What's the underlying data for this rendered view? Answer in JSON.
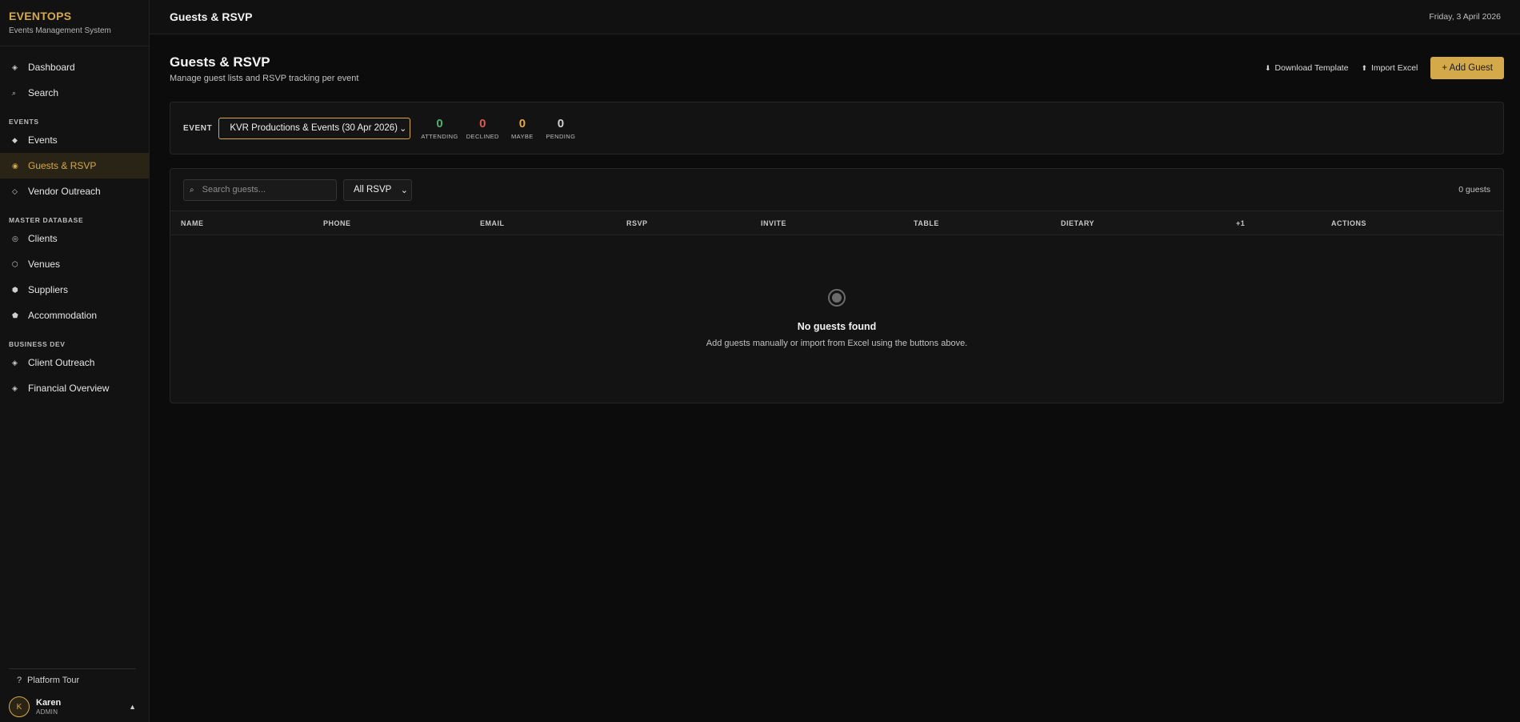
{
  "brand": {
    "name": "EVENTOPS",
    "subtitle": "Events Management System"
  },
  "sidebar": {
    "items": [
      {
        "label": "Dashboard",
        "icon": "◈"
      },
      {
        "label": "Search",
        "icon": "⌕"
      }
    ],
    "sections": [
      {
        "title": "EVENTS",
        "items": [
          {
            "label": "Events",
            "icon": "◆"
          },
          {
            "label": "Guests & RSVP",
            "icon": "◉",
            "active": true
          },
          {
            "label": "Vendor Outreach",
            "icon": "◇"
          }
        ]
      },
      {
        "title": "MASTER DATABASE",
        "items": [
          {
            "label": "Clients",
            "icon": "◎"
          },
          {
            "label": "Venues",
            "icon": "⬡"
          },
          {
            "label": "Suppliers",
            "icon": "⬢"
          },
          {
            "label": "Accommodation",
            "icon": "⬟"
          }
        ]
      },
      {
        "title": "BUSINESS DEV",
        "items": [
          {
            "label": "Client Outreach",
            "icon": "◈"
          },
          {
            "label": "Financial Overview",
            "icon": "◈"
          }
        ]
      }
    ],
    "footer": {
      "tour_label": "Platform Tour",
      "tour_icon": "?",
      "user": {
        "initial": "K",
        "name": "Karen",
        "role": "ADMIN",
        "caret": "▲"
      }
    }
  },
  "topbar": {
    "title": "Guests & RSVP",
    "date": "Friday, 3 April 2026"
  },
  "page": {
    "title": "Guests & RSVP",
    "subtitle": "Manage guest lists and RSVP tracking per event",
    "actions": {
      "download_label": "Download Template",
      "download_icon": "⬇",
      "import_label": "Import Excel",
      "import_icon": "⬆",
      "add_label": "+ Add Guest"
    }
  },
  "event_filter": {
    "label": "EVENT",
    "selected": "KVR Productions & Events (30 Apr 2026)",
    "stats": [
      {
        "value": "0",
        "label": "ATTENDING",
        "color": "#4caf6e"
      },
      {
        "value": "0",
        "label": "DECLINED",
        "color": "#e05a4a"
      },
      {
        "value": "0",
        "label": "MAYBE",
        "color": "#e3a64a"
      },
      {
        "value": "0",
        "label": "PENDING",
        "color": "#cfcfcf"
      }
    ]
  },
  "guests": {
    "search_placeholder": "Search guests...",
    "rsvp_filter": "All RSVP",
    "count_label": "0 guests",
    "columns": [
      "NAME",
      "PHONE",
      "EMAIL",
      "RSVP",
      "INVITE",
      "TABLE",
      "DIETARY",
      "+1",
      "ACTIONS"
    ],
    "empty": {
      "title": "No guests found",
      "message": "Add guests manually or import from Excel using the buttons above."
    }
  },
  "colors": {
    "accent": "#d4a94a",
    "background": "#0c0c0c",
    "panel": "#131313"
  }
}
